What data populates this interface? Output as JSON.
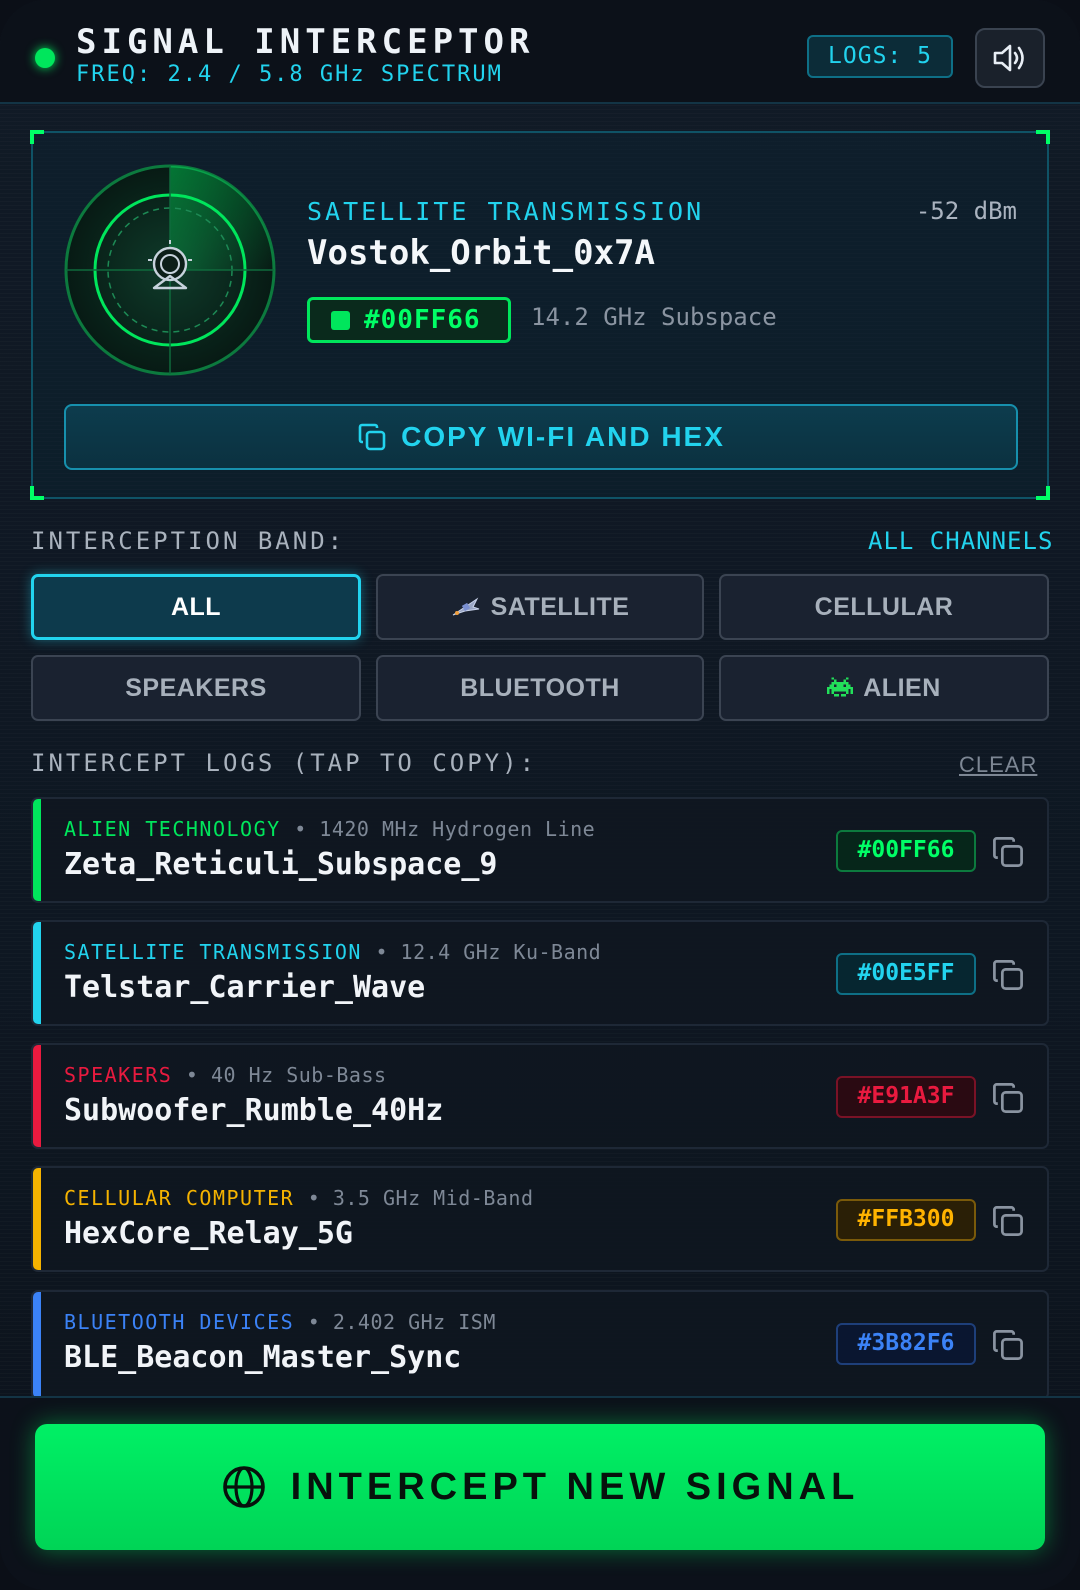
{
  "header": {
    "title": "SIGNAL INTERCEPTOR",
    "subtitle": "FREQ: 2.4 / 5.8 GHz SPECTRUM",
    "logs_badge": "LOGS: 5",
    "sound_icon": "speaker-volume-icon"
  },
  "featured": {
    "category": "SATELLITE TRANSMISSION",
    "signal_strength": "-52 dBm",
    "name": "Vostok_Orbit_0x7A",
    "hex": "#00FF66",
    "frequency": "14.2 GHz Subspace",
    "copy_button": "COPY WI-FI AND HEX",
    "radar_icon": "satellite-dish-icon",
    "accent": "#00E65C"
  },
  "bands": {
    "label": "INTERCEPTION BAND:",
    "all_channels": "ALL CHANNELS",
    "items": [
      {
        "label": "ALL",
        "active": true
      },
      {
        "label": "SATELLITE",
        "icon": "satellite-icon"
      },
      {
        "label": "CELLULAR"
      },
      {
        "label": "SPEAKERS"
      },
      {
        "label": "BLUETOOTH"
      },
      {
        "label": "ALIEN",
        "icon": "alien-invader-icon"
      }
    ]
  },
  "logs": {
    "label": "INTERCEPT LOGS (TAP TO COPY):",
    "clear": "CLEAR",
    "items": [
      {
        "category": "ALIEN TECHNOLOGY",
        "freq": "• 1420 MHz Hydrogen Line",
        "name": "Zeta_Reticuli_Subspace_9",
        "hex": "#00FF66",
        "color": "#00E65C"
      },
      {
        "category": "SATELLITE TRANSMISSION",
        "freq": "• 12.4 GHz Ku-Band",
        "name": "Telstar_Carrier_Wave",
        "hex": "#00E5FF",
        "color": "#22D3EE"
      },
      {
        "category": "SPEAKERS",
        "freq": "• 40 Hz Sub-Bass",
        "name": "Subwoofer_Rumble_40Hz",
        "hex": "#E91A3F",
        "color": "#E91A3F"
      },
      {
        "category": "CELLULAR COMPUTER",
        "freq": "• 3.5 GHz Mid-Band",
        "name": "HexCore_Relay_5G",
        "hex": "#FFB300",
        "color": "#F5B300"
      },
      {
        "category": "BLUETOOTH DEVICES",
        "freq": "• 2.402 GHz ISM",
        "name": "BLE_Beacon_Master_Sync",
        "hex": "#3B82F6",
        "color": "#3B82F6"
      }
    ]
  },
  "action": {
    "label": "INTERCEPT NEW SIGNAL",
    "icon": "globe-icon"
  }
}
